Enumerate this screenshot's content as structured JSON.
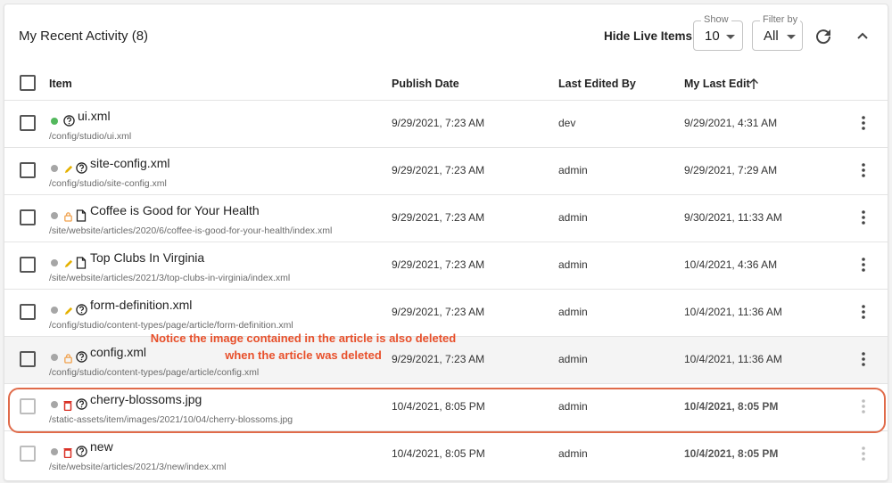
{
  "header": {
    "title": "My Recent Activity (8)",
    "hide_live": "Hide Live Items",
    "show": {
      "label": "Show",
      "value": "10"
    },
    "filter": {
      "label": "Filter by",
      "value": "All"
    }
  },
  "columns": {
    "item": "Item",
    "publish_date": "Publish Date",
    "last_edited_by": "Last Edited By",
    "my_last_edit": "My Last Edit"
  },
  "rows": [
    {
      "name": "ui.xml",
      "path": "/config/studio/ui.xml",
      "publish": "9/29/2021, 7:23 AM",
      "editor": "dev",
      "last_edit": "9/29/2021, 4:31 AM",
      "status_icon": "none",
      "type_icon": "question-icon",
      "dot": "green"
    },
    {
      "name": "site-config.xml",
      "path": "/config/studio/site-config.xml",
      "publish": "9/29/2021, 7:23 AM",
      "editor": "admin",
      "last_edit": "9/29/2021, 7:29 AM",
      "status_icon": "pencil-icon",
      "type_icon": "question-icon",
      "dot": "grey"
    },
    {
      "name": "Coffee is Good for Your Health",
      "path": "/site/website/articles/2020/6/coffee-is-good-for-your-health/index.xml",
      "publish": "9/29/2021, 7:23 AM",
      "editor": "admin",
      "last_edit": "9/30/2021, 11:33 AM",
      "status_icon": "lock-icon",
      "type_icon": "page-icon",
      "dot": "grey"
    },
    {
      "name": "Top Clubs In Virginia",
      "path": "/site/website/articles/2021/3/top-clubs-in-virginia/index.xml",
      "publish": "9/29/2021, 7:23 AM",
      "editor": "admin",
      "last_edit": "10/4/2021, 4:36 AM",
      "status_icon": "pencil-icon",
      "type_icon": "page-icon",
      "dot": "grey"
    },
    {
      "name": "form-definition.xml",
      "path": "/config/studio/content-types/page/article/form-definition.xml",
      "publish": "9/29/2021, 7:23 AM",
      "editor": "admin",
      "last_edit": "10/4/2021, 11:36 AM",
      "status_icon": "pencil-icon",
      "type_icon": "question-icon",
      "dot": "grey"
    },
    {
      "name": "config.xml",
      "path": "/config/studio/content-types/page/article/config.xml",
      "publish": "9/29/2021, 7:23 AM",
      "editor": "admin",
      "last_edit": "10/4/2021, 11:36 AM",
      "status_icon": "lock-icon",
      "type_icon": "question-icon",
      "dot": "grey"
    },
    {
      "name": "cherry-blossoms.jpg",
      "path": "/static-assets/item/images/2021/10/04/cherry-blossoms.jpg",
      "publish": "10/4/2021, 8:05 PM",
      "editor": "admin",
      "last_edit": "10/4/2021, 8:05 PM",
      "status_icon": "trash-icon",
      "type_icon": "question-icon",
      "dot": "grey"
    },
    {
      "name": "new",
      "path": "/site/website/articles/2021/3/new/index.xml",
      "publish": "10/4/2021, 8:05 PM",
      "editor": "admin",
      "last_edit": "10/4/2021, 8:05 PM",
      "status_icon": "trash-icon",
      "type_icon": "question-icon",
      "dot": "grey"
    }
  ],
  "annotation": {
    "line1": "Notice the image contained in the article is also deleted",
    "line2": "when the article was deleted"
  },
  "colors": {
    "accent_red": "#e8502b",
    "status_green": "#53b85d",
    "pencil": "#e5b100",
    "lock": "#f0a04b",
    "trash": "#d93025"
  }
}
